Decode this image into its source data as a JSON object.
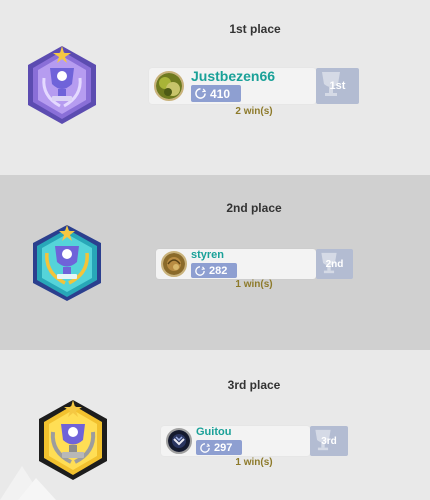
{
  "entries": [
    {
      "place_label": "1st place",
      "username": "Justbezen66",
      "score": "410",
      "rank": "1st",
      "wins": "2 win(s)",
      "badge_icon": "purple-trophy-badge-icon",
      "avatar_icon": "moss-avatar-icon"
    },
    {
      "place_label": "2nd place",
      "username": "styren",
      "score": "282",
      "rank": "2nd",
      "wins": "1 win(s)",
      "badge_icon": "teal-trophy-badge-icon",
      "avatar_icon": "shell-avatar-icon"
    },
    {
      "place_label": "3rd place",
      "username": "Guitou",
      "score": "297",
      "rank": "3rd",
      "wins": "1 win(s)",
      "badge_icon": "black-gold-trophy-badge-icon",
      "avatar_icon": "dark-emblem-avatar-icon"
    }
  ],
  "colors": {
    "username": "#1aa198",
    "score_pill": "#8e9fd1",
    "rank_tab": "#b3bcd2",
    "wins_text": "#8d7a2a",
    "band_light": "#e9e9e9",
    "band_dark": "#d0d0d0"
  }
}
